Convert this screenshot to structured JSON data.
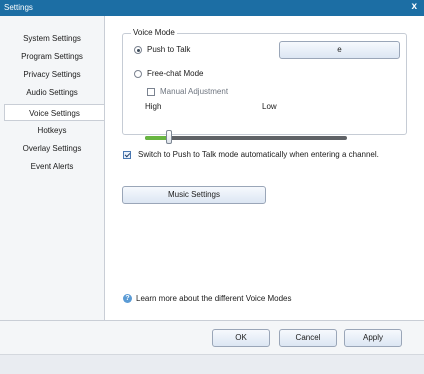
{
  "window": {
    "title": "Settings",
    "close_glyph": "x"
  },
  "sidebar": {
    "items": [
      {
        "label": "System Settings"
      },
      {
        "label": "Program Settings"
      },
      {
        "label": "Privacy Settings"
      },
      {
        "label": "Audio Settings"
      },
      {
        "label": "Voice Settings",
        "selected": true
      },
      {
        "label": "Hotkeys"
      },
      {
        "label": "Overlay Settings"
      },
      {
        "label": "Event Alerts"
      }
    ]
  },
  "voice_mode": {
    "group_title": "Voice Mode",
    "push_to_talk_label": "Push to Talk",
    "push_to_talk_selected": true,
    "hotkey_value": "e",
    "free_chat_label": "Free-chat Mode",
    "free_chat_selected": false,
    "manual_adjustment_label": "Manual Adjustment",
    "manual_adjustment_checked": false,
    "slider_high_label": "High",
    "slider_low_label": "Low",
    "slider_level": 0.12
  },
  "auto_ptt": {
    "label": "Switch to Push to Talk mode automatically when entering a channel.",
    "checked": true
  },
  "music_settings_label": "Music Settings",
  "info_icon": {
    "glyph": "?"
  },
  "learn_more_label": "Learn more about the different Voice Modes",
  "footer": {
    "ok_label": "OK",
    "cancel_label": "Cancel",
    "apply_label": "Apply"
  },
  "colors": {
    "titlebar": "#1c6ea4",
    "slider_fill": "#68b541",
    "slider_track": "#5f6266"
  }
}
